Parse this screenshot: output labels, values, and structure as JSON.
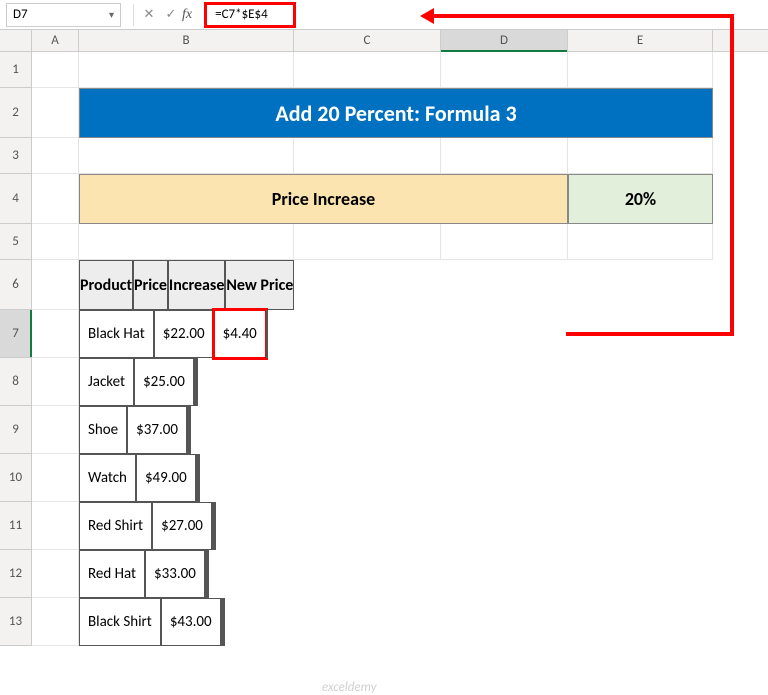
{
  "name_box": "D7",
  "formula": "=C7*$E$4",
  "fx": "fx",
  "col_labels": {
    "A": "A",
    "B": "B",
    "C": "C",
    "D": "D",
    "E": "E"
  },
  "row_labels": [
    "1",
    "2",
    "3",
    "4",
    "5",
    "6",
    "7",
    "8",
    "9",
    "10",
    "11",
    "12",
    "13"
  ],
  "title": "Add 20 Percent: Formula 3",
  "price_increase_label": "Price Increase",
  "percent_value": "20%",
  "headers": {
    "product": "Product",
    "price": "Price",
    "increase": "Increase",
    "new_price": "New Price"
  },
  "currency": "$",
  "rows": [
    {
      "product": "Black Hat",
      "price": "22.00",
      "increase": "4.40"
    },
    {
      "product": "Jacket",
      "price": "25.00",
      "increase": ""
    },
    {
      "product": "Shoe",
      "price": "37.00",
      "increase": ""
    },
    {
      "product": "Watch",
      "price": "49.00",
      "increase": ""
    },
    {
      "product": "Red Shirt",
      "price": "27.00",
      "increase": ""
    },
    {
      "product": "Red Hat",
      "price": "33.00",
      "increase": ""
    },
    {
      "product": "Black Shirt",
      "price": "43.00",
      "increase": ""
    }
  ],
  "watermark": "exceldemy",
  "chart_data": {
    "type": "table",
    "title": "Add 20 Percent: Formula 3",
    "columns": [
      "Product",
      "Price",
      "Increase",
      "New Price"
    ],
    "percent_increase": 0.2,
    "rows": [
      {
        "Product": "Black Hat",
        "Price": 22.0,
        "Increase": 4.4,
        "New Price": null
      },
      {
        "Product": "Jacket",
        "Price": 25.0,
        "Increase": null,
        "New Price": null
      },
      {
        "Product": "Shoe",
        "Price": 37.0,
        "Increase": null,
        "New Price": null
      },
      {
        "Product": "Watch",
        "Price": 49.0,
        "Increase": null,
        "New Price": null
      },
      {
        "Product": "Red Shirt",
        "Price": 27.0,
        "Increase": null,
        "New Price": null
      },
      {
        "Product": "Red Hat",
        "Price": 33.0,
        "Increase": null,
        "New Price": null
      },
      {
        "Product": "Black Shirt",
        "Price": 43.0,
        "Increase": null,
        "New Price": null
      }
    ]
  }
}
